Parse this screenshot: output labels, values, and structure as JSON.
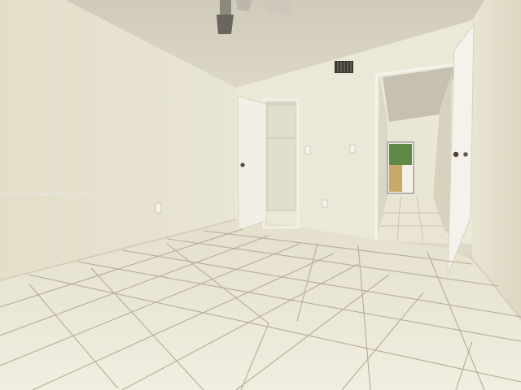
{
  "photo": {
    "watermark": "A1131868 © Miami MLS® 2025"
  },
  "colors": {
    "left_wall": "#e6e1cf",
    "back_wall": "#ece8d8",
    "ceiling": "#d9d4c4",
    "floor_tile": "#ece8d6",
    "grout": "#b9b09a",
    "door": "#f3f1e8"
  }
}
